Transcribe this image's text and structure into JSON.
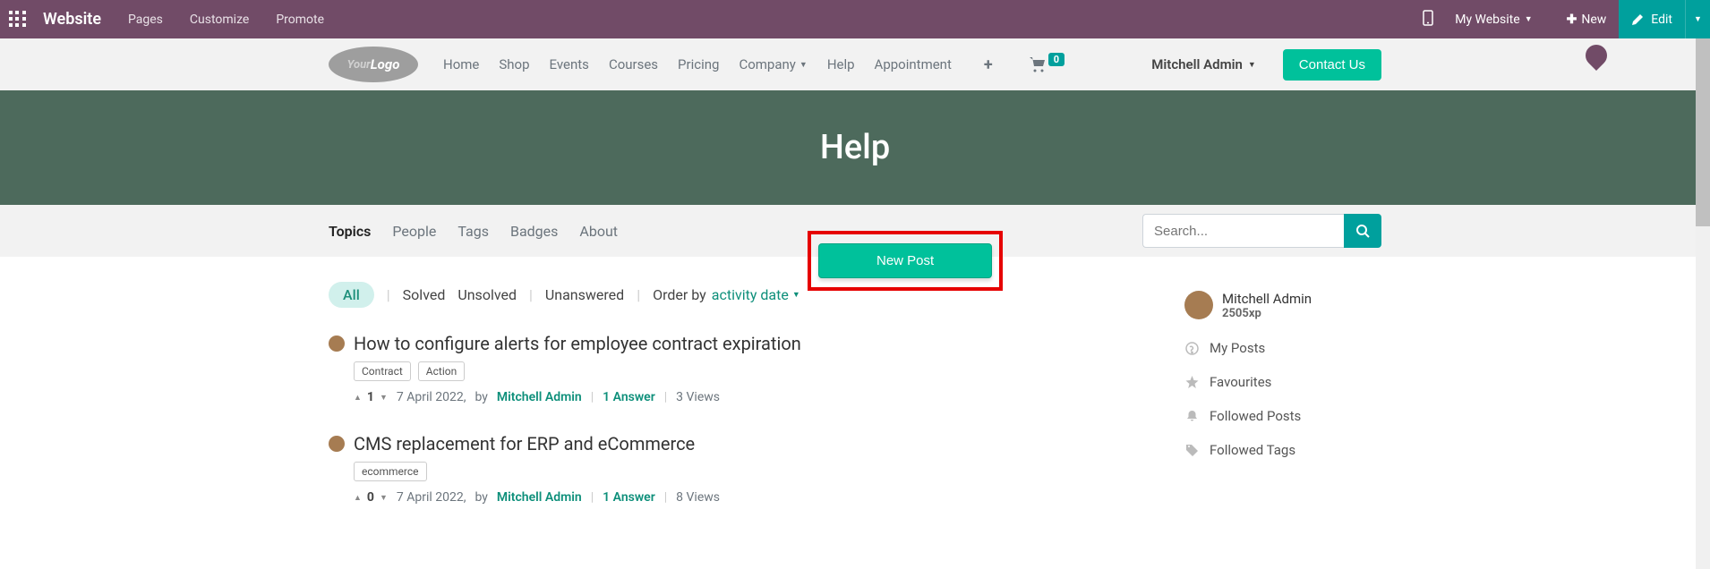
{
  "topbar": {
    "brand": "Website",
    "nav": [
      "Pages",
      "Customize",
      "Promote"
    ],
    "my_website": "My Website",
    "new_btn": "New",
    "edit_btn": "Edit"
  },
  "siteheader": {
    "logo_text_1": "Your",
    "logo_text_2": "Logo",
    "nav": [
      "Home",
      "Shop",
      "Events",
      "Courses",
      "Pricing",
      "Company",
      "Help",
      "Appointment"
    ],
    "cart_count": "0",
    "user": "Mitchell Admin",
    "contact_btn": "Contact Us"
  },
  "hero": {
    "title": "Help"
  },
  "tabs": [
    "Topics",
    "People",
    "Tags",
    "Badges",
    "About"
  ],
  "search": {
    "placeholder": "Search..."
  },
  "filters": {
    "all": "All",
    "solved": "Solved",
    "unsolved": "Unsolved",
    "unanswered": "Unanswered",
    "order_by_label": "Order by",
    "order_by_value": "activity date"
  },
  "newpost": "New Post",
  "posts": [
    {
      "title": "How to configure alerts for employee contract expiration",
      "tags": [
        "Contract",
        "Action"
      ],
      "votes": "1",
      "date": "7 April 2022,",
      "by": "by",
      "author": "Mitchell Admin",
      "answers": "1 Answer",
      "views": "3 Views"
    },
    {
      "title": "CMS replacement for ERP and eCommerce",
      "tags": [
        "ecommerce"
      ],
      "votes": "0",
      "date": "7 April 2022,",
      "by": "by",
      "author": "Mitchell Admin",
      "answers": "1 Answer",
      "views": "8 Views"
    }
  ],
  "sidebar": {
    "user": "Mitchell Admin",
    "xp": "2505xp",
    "links": [
      "My Posts",
      "Favourites",
      "Followed Posts",
      "Followed Tags"
    ]
  }
}
